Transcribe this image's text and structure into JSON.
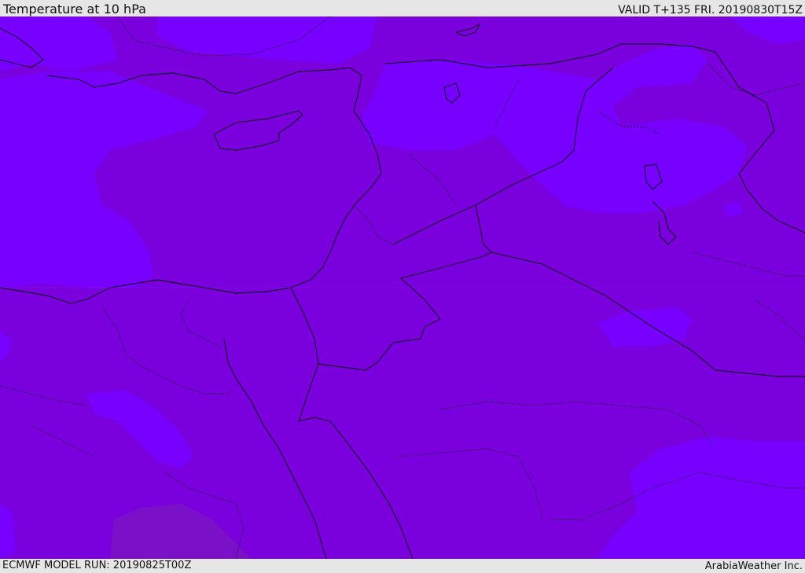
{
  "header": {
    "title": "Temperature at 10 hPa",
    "valid": "VALID T+135 FRI. 20190830T15Z"
  },
  "footer": {
    "model_run": "ECMWF MODEL RUN: 20190825T00Z",
    "credit": "ArabiaWeather Inc."
  },
  "colors": {
    "field_light": "#7700ff",
    "field_dark": "#7a00dd",
    "field_darker": "#7a10c8",
    "border_line": "#000000",
    "bar_bg": "#e6e6e6"
  }
}
